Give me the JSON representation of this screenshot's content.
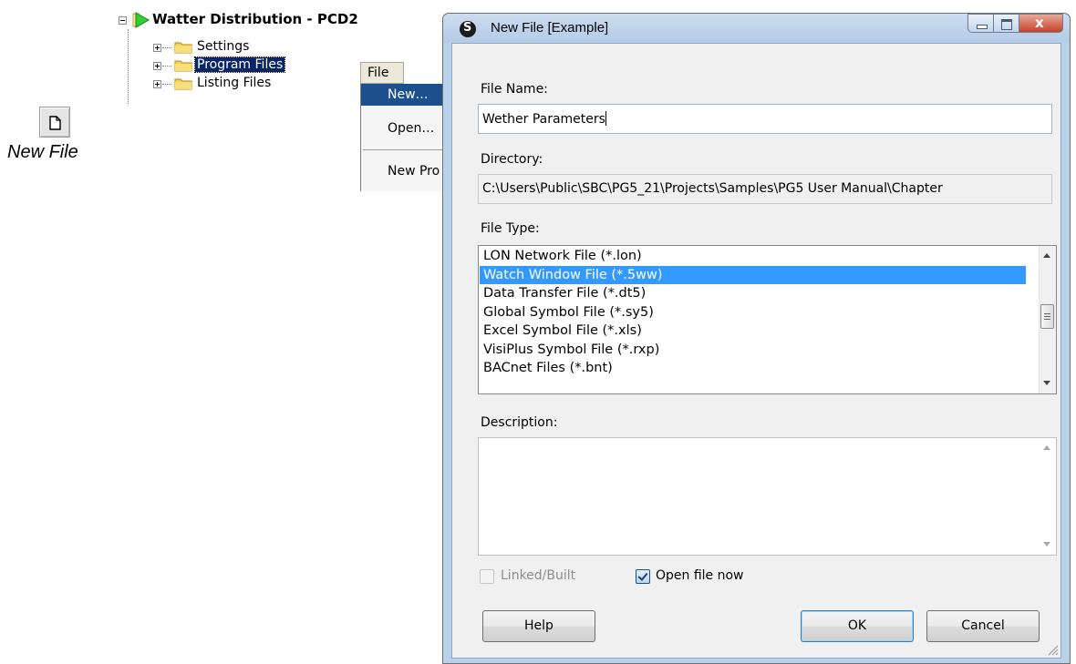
{
  "toolbar": {
    "new_file_caption": "New File",
    "new_file_icon": "new-file-icon"
  },
  "tree": {
    "root_label": "Watter Distribution - PCD2",
    "root_icon": "green-play-icon",
    "items": [
      {
        "label": "Settings",
        "selected": false
      },
      {
        "label": "Program Files",
        "selected": true
      },
      {
        "label": "Listing Files",
        "selected": false
      }
    ]
  },
  "menu": {
    "title": "File",
    "items": [
      "New…",
      "Open…",
      "New Pro"
    ],
    "highlighted": "New…"
  },
  "dialog": {
    "title": "New File [Example]",
    "file_name_label": "File Name:",
    "file_name_value": "Wether Parameters",
    "directory_label": "Directory:",
    "directory_value": "C:\\Users\\Public\\SBC\\PG5_21\\Projects\\Samples\\PG5 User Manual\\Chapter",
    "file_type_label": "File Type:",
    "file_types": [
      "LON Network File (*.lon)",
      "Watch Window File (*.5ww)",
      "Data Transfer File (*.dt5)",
      "Global Symbol File (*.sy5)",
      "Excel Symbol File (*.xls)",
      "VisiPlus Symbol File (*.rxp)",
      "BACnet Files (*.bnt)"
    ],
    "selected_file_type": "Watch Window File (*.5ww)",
    "description_label": "Description:",
    "description_value": "",
    "linked_built_label": "Linked/Built",
    "linked_built_checked": false,
    "linked_built_enabled": false,
    "open_file_now_label": "Open file now",
    "open_file_now_checked": true,
    "help_label": "Help",
    "ok_label": "OK",
    "cancel_label": "Cancel"
  },
  "colors": {
    "selection": "#3399ff",
    "menu_highlight": "#1c4f8c",
    "tree_selection": "#0a246a",
    "dialog_frame": "#b9d1ea",
    "close_button": "#c4422b"
  }
}
